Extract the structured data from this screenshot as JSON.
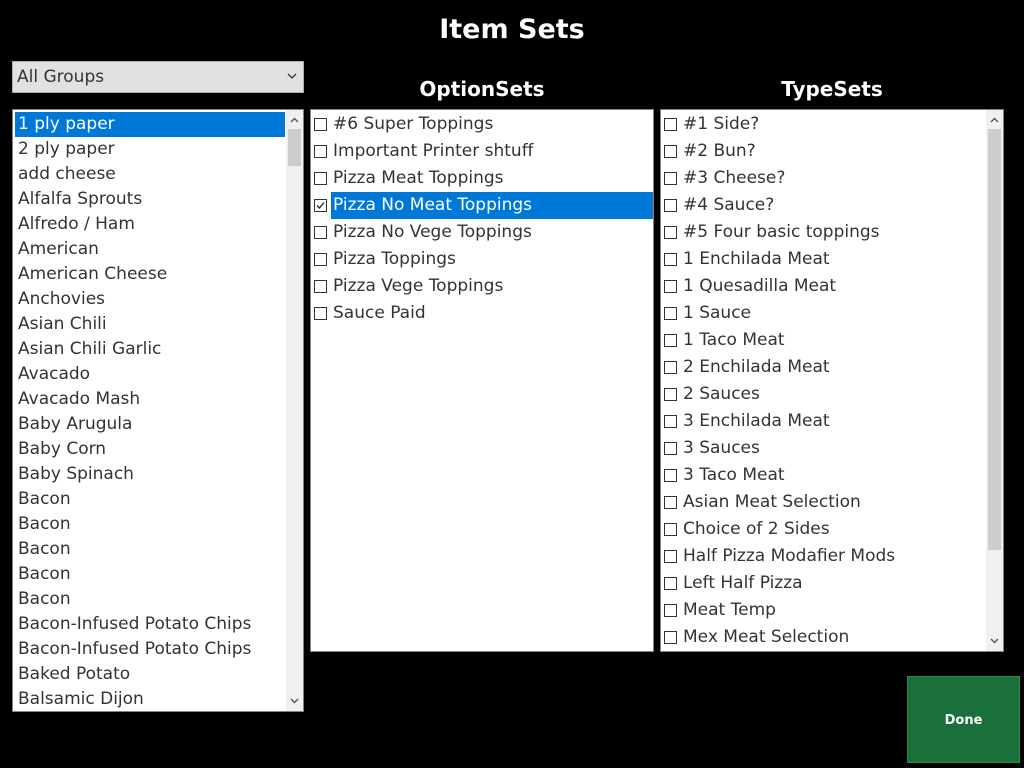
{
  "title": "Item Sets",
  "group_select": {
    "value": "All Groups"
  },
  "headers": {
    "option_sets": "OptionSets",
    "type_sets": "TypeSets"
  },
  "items": [
    {
      "label": "1 ply paper",
      "selected": true
    },
    {
      "label": "2 ply paper"
    },
    {
      "label": "add cheese"
    },
    {
      "label": "Alfalfa Sprouts"
    },
    {
      "label": "Alfredo / Ham"
    },
    {
      "label": "American"
    },
    {
      "label": "American Cheese"
    },
    {
      "label": "Anchovies"
    },
    {
      "label": "Asian Chili"
    },
    {
      "label": "Asian Chili Garlic"
    },
    {
      "label": "Avacado"
    },
    {
      "label": "Avacado Mash"
    },
    {
      "label": "Baby Arugula"
    },
    {
      "label": "Baby Corn"
    },
    {
      "label": "Baby Spinach"
    },
    {
      "label": "Bacon"
    },
    {
      "label": "Bacon"
    },
    {
      "label": "Bacon"
    },
    {
      "label": "Bacon"
    },
    {
      "label": "Bacon"
    },
    {
      "label": "Bacon-Infused Potato Chips"
    },
    {
      "label": "Bacon-Infused Potato Chips"
    },
    {
      "label": "Baked Potato"
    },
    {
      "label": "Balsamic Dijon"
    }
  ],
  "option_sets": [
    {
      "label": "#6 Super Toppings",
      "checked": false
    },
    {
      "label": "Important Printer shtuff",
      "checked": false
    },
    {
      "label": "Pizza Meat Toppings",
      "checked": false
    },
    {
      "label": "Pizza No Meat Toppings",
      "checked": true,
      "selected": true
    },
    {
      "label": "Pizza No Vege Toppings",
      "checked": false
    },
    {
      "label": "Pizza Toppings",
      "checked": false
    },
    {
      "label": "Pizza Vege Toppings",
      "checked": false
    },
    {
      "label": "Sauce Paid",
      "checked": false
    }
  ],
  "type_sets": [
    {
      "label": "#1 Side?",
      "checked": false
    },
    {
      "label": "#2 Bun?",
      "checked": false
    },
    {
      "label": "#3 Cheese?",
      "checked": false
    },
    {
      "label": "#4 Sauce?",
      "checked": false
    },
    {
      "label": "#5 Four basic toppings",
      "checked": false
    },
    {
      "label": "1 Enchilada Meat",
      "checked": false
    },
    {
      "label": "1 Quesadilla Meat",
      "checked": false
    },
    {
      "label": "1 Sauce",
      "checked": false
    },
    {
      "label": "1 Taco Meat",
      "checked": false
    },
    {
      "label": "2 Enchilada Meat",
      "checked": false
    },
    {
      "label": "2 Sauces",
      "checked": false
    },
    {
      "label": "3 Enchilada Meat",
      "checked": false
    },
    {
      "label": "3 Sauces",
      "checked": false
    },
    {
      "label": "3 Taco Meat",
      "checked": false
    },
    {
      "label": "Asian Meat Selection",
      "checked": false
    },
    {
      "label": "Choice of 2 Sides",
      "checked": false
    },
    {
      "label": "Half Pizza Modafier Mods",
      "checked": false
    },
    {
      "label": "Left Half Pizza",
      "checked": false
    },
    {
      "label": "Meat Temp",
      "checked": false
    },
    {
      "label": "Mex Meat Selection",
      "checked": false
    }
  ],
  "done_label": "Done",
  "colors": {
    "selection": "#0078d7",
    "done": "#19703a",
    "background": "#000000"
  }
}
